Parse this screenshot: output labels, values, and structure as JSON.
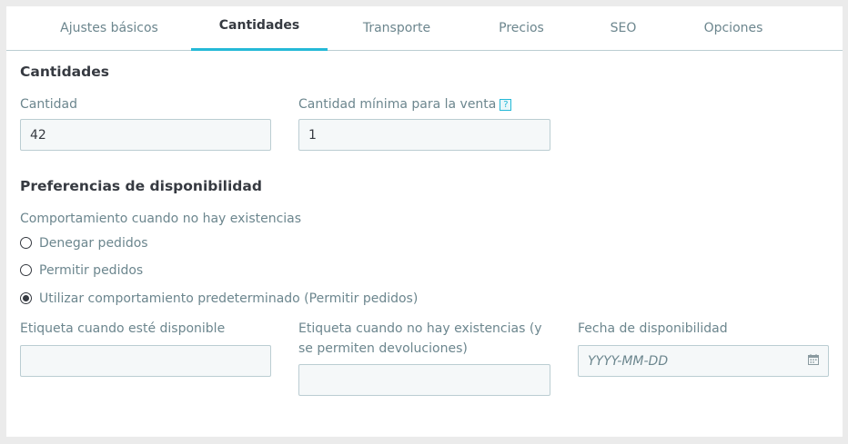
{
  "tabs": [
    {
      "label": "Ajustes básicos"
    },
    {
      "label": "Cantidades"
    },
    {
      "label": "Transporte"
    },
    {
      "label": "Precios"
    },
    {
      "label": "SEO"
    },
    {
      "label": "Opciones"
    }
  ],
  "active_tab": "Cantidades",
  "quantities": {
    "heading": "Cantidades",
    "quantity_label": "Cantidad",
    "quantity_value": "42",
    "min_qty_label": "Cantidad mínima para la venta",
    "help_glyph": "?",
    "min_qty_value": "1"
  },
  "availability": {
    "heading": "Preferencias de disponibilidad",
    "behavior_label": "Comportamiento cuando no hay existencias",
    "options": [
      {
        "label": "Denegar pedidos",
        "checked": false
      },
      {
        "label": "Permitir pedidos",
        "checked": false
      },
      {
        "label": "Utilizar comportamiento predeterminado (Permitir pedidos)",
        "checked": true
      }
    ],
    "in_stock_label": "Etiqueta cuando esté disponible",
    "in_stock_value": "",
    "out_of_stock_label": "Etiqueta cuando no hay existencias (y se permiten devoluciones)",
    "out_of_stock_value": "",
    "date_label": "Fecha de disponibilidad",
    "date_placeholder": "YYYY-MM-DD",
    "date_value": ""
  },
  "colors": {
    "accent": "#25b9d7",
    "text": "#363a41",
    "muted": "#6c868e",
    "border": "#bbcdd2",
    "input_bg": "#f5f8f9"
  },
  "icons": {
    "help": "help-icon",
    "calendar": "calendar-icon"
  }
}
